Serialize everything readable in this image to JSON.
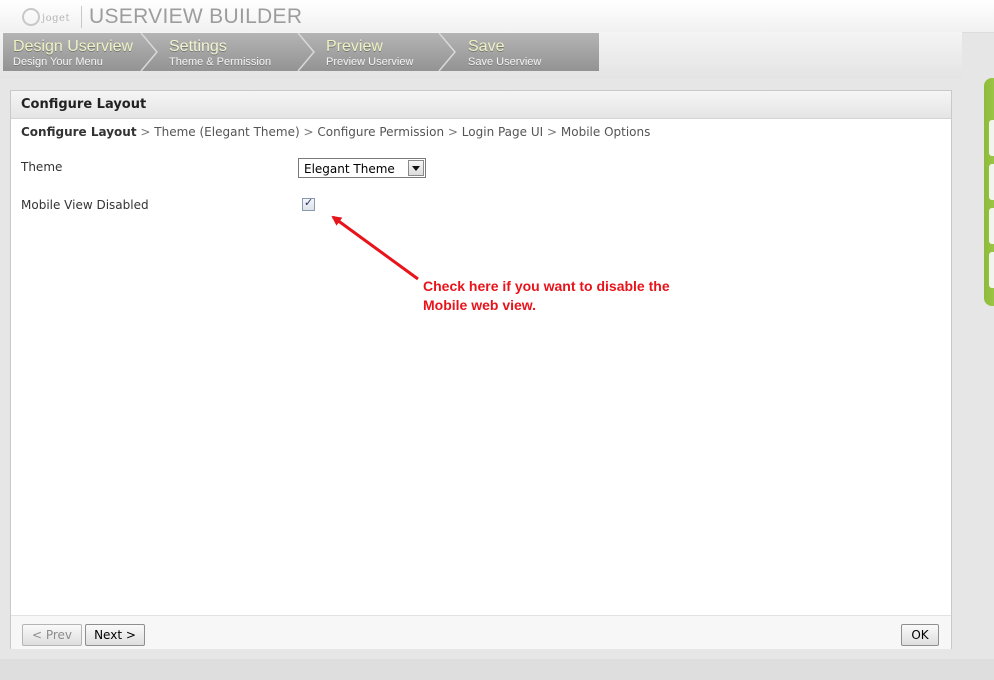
{
  "header": {
    "logo_text": "joget",
    "app_title": "USERVIEW BUILDER"
  },
  "wizard": {
    "steps": [
      {
        "title": "Design Userview",
        "subtitle": "Design Your Menu"
      },
      {
        "title": "Settings",
        "subtitle": "Theme & Permission"
      },
      {
        "title": "Preview",
        "subtitle": "Preview Userview"
      },
      {
        "title": "Save",
        "subtitle": "Save Userview"
      }
    ],
    "active_index": 1
  },
  "panel": {
    "title": "Configure Layout",
    "breadcrumb": {
      "current": "Configure Layout",
      "items": [
        "Theme (Elegant Theme)",
        "Configure Permission",
        "Login Page UI",
        "Mobile Options"
      ],
      "separator": ">"
    },
    "fields": {
      "theme_label": "Theme",
      "theme_value": "Elegant Theme",
      "mobile_label": "Mobile View Disabled",
      "mobile_checked": true
    },
    "annotation": {
      "line1": "Check here if you want to disable the",
      "line2": "Mobile web view.",
      "color": "#e8141b"
    },
    "footer": {
      "prev_label": "< Prev",
      "next_label": "Next >",
      "ok_label": "OK"
    }
  },
  "colors": {
    "accent_green": "#a9cf52",
    "step_text": "#eef2c2"
  }
}
